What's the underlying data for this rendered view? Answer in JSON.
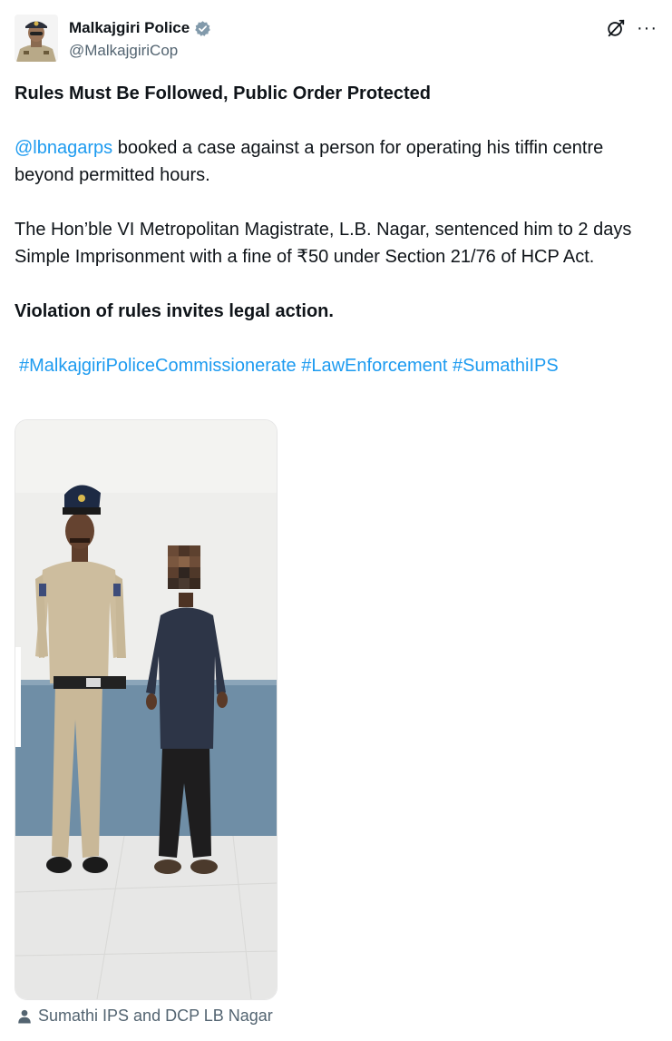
{
  "author": {
    "display_name": "Malkajgiri Police",
    "handle": "@MalkajgiriCop",
    "verified": true
  },
  "icons": {
    "verified": "verified-badge-icon",
    "grok": "grok-icon",
    "more": "more-options-icon",
    "person": "person-tag-icon"
  },
  "colors": {
    "link": "#1d9bf0",
    "text": "#0f1419",
    "secondary": "#536471"
  },
  "tweet": {
    "headline": "Rules Must Be Followed, Public Order Protected",
    "p1_mention": "@lbnagarps",
    "p1_rest": " booked a case against a person for operating his tiffin centre beyond permitted hours.",
    "p2": "The Hon’ble VI Metropolitan Magistrate, L.B. Nagar, sentenced him to 2 days Simple Imprisonment with a fine of ₹50 under Section 21/76 of HCP Act.",
    "p3": "Violation of rules invites legal action.",
    "hashtags": [
      "#MalkajgiriPoliceCommissionerate",
      "#LawEnforcement",
      "#SumathiIPS"
    ]
  },
  "media": {
    "tagged": "Sumathi IPS and DCP LB Nagar"
  }
}
